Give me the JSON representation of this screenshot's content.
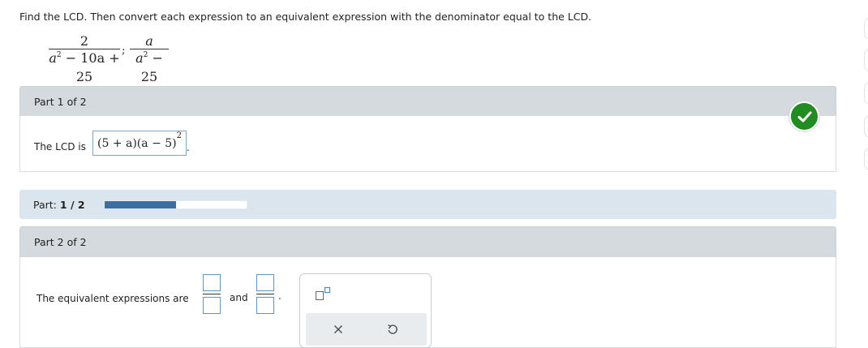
{
  "instruction": "Find the LCD. Then convert each expression to an equivalent expression with the denominator equal to the LCD.",
  "problem": {
    "frac1": {
      "num": "2",
      "den_pre": "a",
      "den_sup": "2",
      "den_post": " − 10a + 25"
    },
    "separator": ";",
    "frac2": {
      "num": "a",
      "den_pre": "a",
      "den_sup": "2",
      "den_post": " − 25"
    }
  },
  "part1": {
    "header": "Part 1 of 2",
    "lcd_label": "The LCD is",
    "lcd_answer_main": "(5 + a)(a − 5)",
    "lcd_answer_sup": "2",
    "trailing": ".",
    "status": "correct"
  },
  "progress": {
    "label": "Part:",
    "value_text": "1 / 2",
    "fraction": 0.5,
    "fill_color": "#3c6ea6"
  },
  "part2": {
    "header": "Part 2 of 2",
    "eq_label": "The equivalent expressions are",
    "and_label": "and",
    "trailing": "."
  },
  "palette": {
    "tool_icon": "superscript-box-icon",
    "clear_icon": "×",
    "undo_icon": "↺"
  },
  "colors": {
    "check": "#228b22",
    "input_border": "#5f95c6",
    "header_bg": "#d4dadd"
  }
}
